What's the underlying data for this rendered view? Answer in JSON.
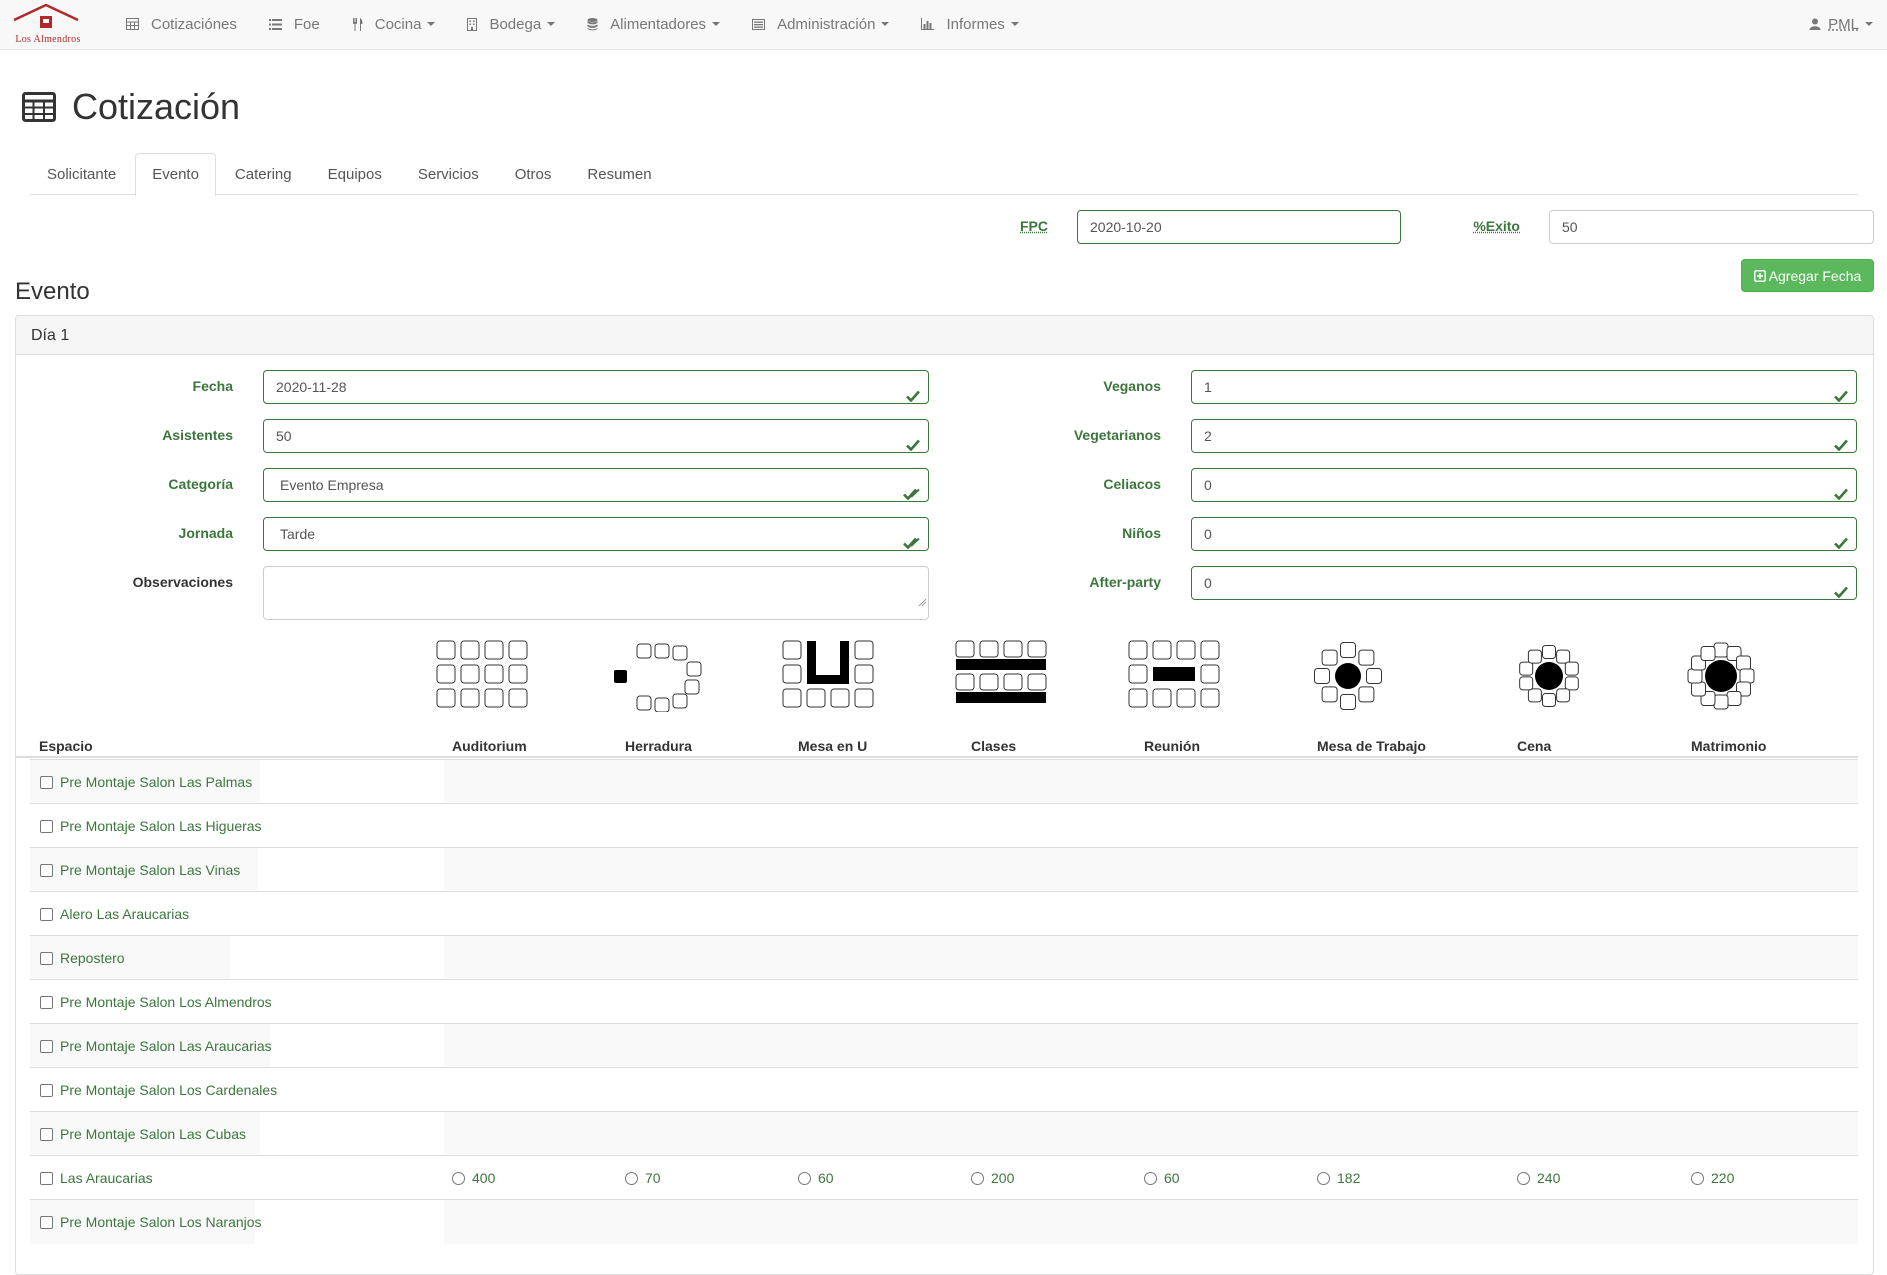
{
  "brand": {
    "name": "Los Almendros",
    "color": "#b02a2a"
  },
  "nav": {
    "items": [
      {
        "label": "Cotizaciónes",
        "icon": "table-icon",
        "dropdown": false
      },
      {
        "label": "Foe",
        "icon": "list-icon",
        "dropdown": false
      },
      {
        "label": "Cocina",
        "icon": "cutlery-icon",
        "dropdown": true
      },
      {
        "label": "Bodega",
        "icon": "building-icon",
        "dropdown": true
      },
      {
        "label": "Alimentadores",
        "icon": "database-icon",
        "dropdown": true
      },
      {
        "label": "Administración",
        "icon": "list-alt-icon",
        "dropdown": true
      },
      {
        "label": "Informes",
        "icon": "bar-chart-icon",
        "dropdown": true
      }
    ],
    "user": "PML"
  },
  "page": {
    "title": "Cotización"
  },
  "tabs": [
    {
      "label": "Solicitante",
      "active": false
    },
    {
      "label": "Evento",
      "active": true
    },
    {
      "label": "Catering",
      "active": false
    },
    {
      "label": "Equipos",
      "active": false
    },
    {
      "label": "Servicios",
      "active": false
    },
    {
      "label": "Otros",
      "active": false
    },
    {
      "label": "Resumen",
      "active": false
    }
  ],
  "top_fields": {
    "fpc_label": "FPC",
    "fpc_value": "2020-10-20",
    "exito_label": "%Exito",
    "exito_value": "50",
    "add_date_button": "Agregar Fecha"
  },
  "section": {
    "title": "Evento",
    "panel_title": "Día 1"
  },
  "form": {
    "left": [
      {
        "label": "Fecha",
        "value": "2020-11-28"
      },
      {
        "label": "Asistentes",
        "value": "50"
      },
      {
        "label": "Categoría",
        "value": "Evento Empresa"
      },
      {
        "label": "Jornada",
        "value": "Tarde"
      },
      {
        "label": "Observaciones",
        "value": ""
      }
    ],
    "right": [
      {
        "label": "Veganos",
        "value": "1"
      },
      {
        "label": "Vegetarianos",
        "value": "2"
      },
      {
        "label": "Celiacos",
        "value": "0"
      },
      {
        "label": "Niños",
        "value": "0"
      },
      {
        "label": "After-party",
        "value": "0"
      }
    ]
  },
  "table": {
    "espacio_header": "Espacio",
    "layouts": [
      "Auditorium",
      "Herradura",
      "Mesa en U",
      "Clases",
      "Reunión",
      "Mesa de Trabajo",
      "Cena",
      "Matrimonio"
    ],
    "rows": [
      {
        "name": "Pre Montaje Salon Las Palmas",
        "capacities": []
      },
      {
        "name": "Pre Montaje Salon Las Higueras",
        "capacities": []
      },
      {
        "name": "Pre Montaje Salon Las Vinas",
        "capacities": []
      },
      {
        "name": "Alero Las Araucarias",
        "capacities": []
      },
      {
        "name": "Repostero",
        "capacities": []
      },
      {
        "name": "Pre Montaje Salon Los Almendros",
        "capacities": []
      },
      {
        "name": "Pre Montaje Salon Las Araucarias",
        "capacities": []
      },
      {
        "name": "Pre Montaje Salon Los Cardenales",
        "capacities": []
      },
      {
        "name": "Pre Montaje Salon Las Cubas",
        "capacities": []
      },
      {
        "name": "Las Araucarias",
        "capacities": [
          "400",
          "70",
          "60",
          "200",
          "60",
          "182",
          "240",
          "220"
        ]
      },
      {
        "name": "Pre Montaje Salon Los Naranjos",
        "capacities": []
      }
    ]
  },
  "colors": {
    "success": "#3c763d",
    "button_green": "#5cb85c"
  }
}
